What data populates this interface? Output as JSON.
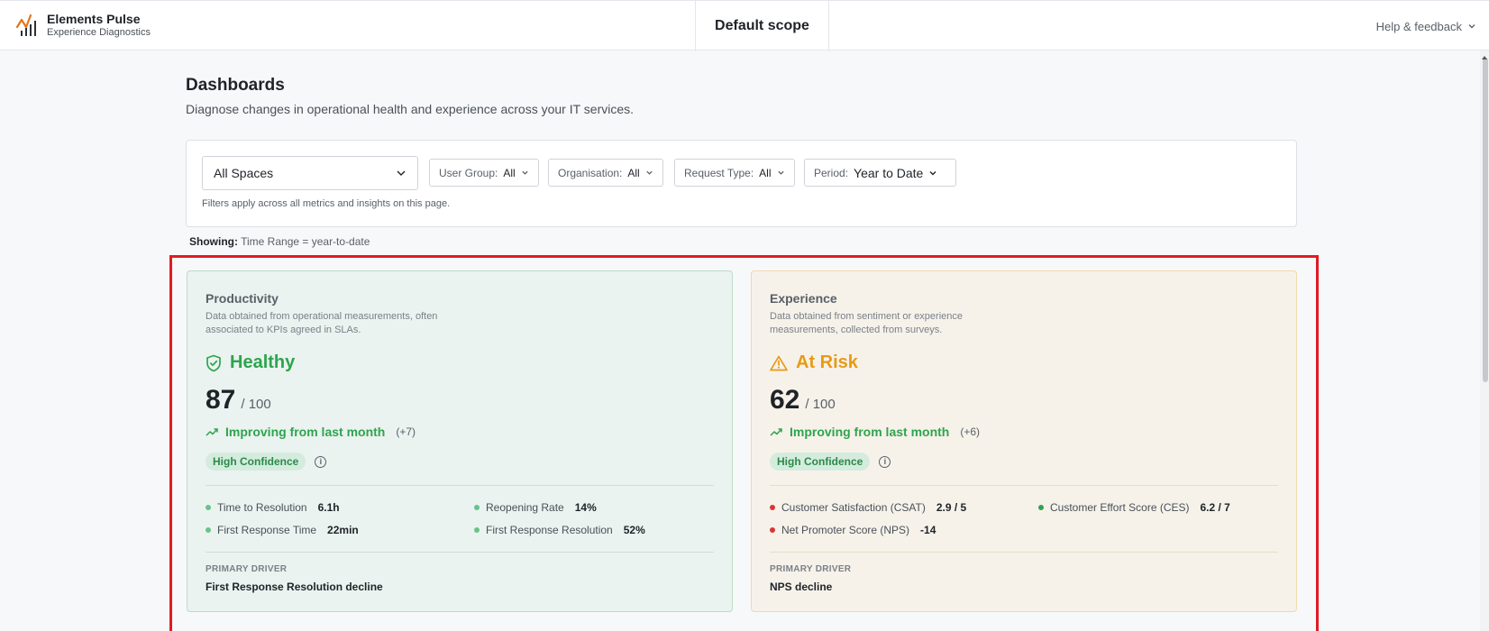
{
  "app": {
    "name": "Elements Pulse",
    "subtitle": "Experience Diagnostics",
    "scope": "Default scope",
    "help_label": "Help & feedback"
  },
  "page": {
    "title": "Dashboards",
    "subtitle": "Diagnose changes in operational health and experience across your IT services."
  },
  "filters": {
    "space_value": "All Spaces",
    "user_group": {
      "label": "User Group:",
      "value": "All"
    },
    "organisation": {
      "label": "Organisation:",
      "value": "All"
    },
    "request_type": {
      "label": "Request Type:",
      "value": "All"
    },
    "period": {
      "label": "Period:",
      "value": "Year to Date"
    },
    "note": "Filters apply across all metrics and insights on this page."
  },
  "showing": {
    "label": "Showing:",
    "value": "Time Range = year-to-date"
  },
  "colors": {
    "good": "#2ea44f",
    "warn": "#e89a14",
    "bad": "#d93636",
    "highlight": "#e01b24"
  },
  "productivity": {
    "title": "Productivity",
    "description": "Data obtained from operational measurements, often associated to KPIs agreed in SLAs.",
    "status": "Healthy",
    "status_icon": "shield-check-icon",
    "score": "87",
    "score_max": "/ 100",
    "trend": "Improving from last month",
    "trend_delta": "(+7)",
    "confidence": "High Confidence",
    "metrics": [
      {
        "label": "Time to Resolution",
        "value": "6.1h",
        "status": "good"
      },
      {
        "label": "Reopening Rate",
        "value": "14%",
        "status": "good"
      },
      {
        "label": "First Response Time",
        "value": "22min",
        "status": "good"
      },
      {
        "label": "First Response Resolution",
        "value": "52%",
        "status": "good"
      }
    ],
    "driver_label": "PRIMARY DRIVER",
    "driver": "First Response Resolution decline"
  },
  "experience": {
    "title": "Experience",
    "description": "Data obtained from sentiment or experience measurements, collected from surveys.",
    "status": "At Risk",
    "status_icon": "warning-triangle-icon",
    "score": "62",
    "score_max": "/ 100",
    "trend": "Improving from last month",
    "trend_delta": "(+6)",
    "confidence": "High Confidence",
    "metrics": [
      {
        "label": "Customer Satisfaction (CSAT)",
        "value": "2.9 / 5",
        "status": "bad"
      },
      {
        "label": "Customer Effort Score (CES)",
        "value": "6.2 / 7",
        "status": "good"
      },
      {
        "label": "Net Promoter Score (NPS)",
        "value": "-14",
        "status": "bad"
      }
    ],
    "driver_label": "PRIMARY DRIVER",
    "driver": "NPS decline"
  }
}
